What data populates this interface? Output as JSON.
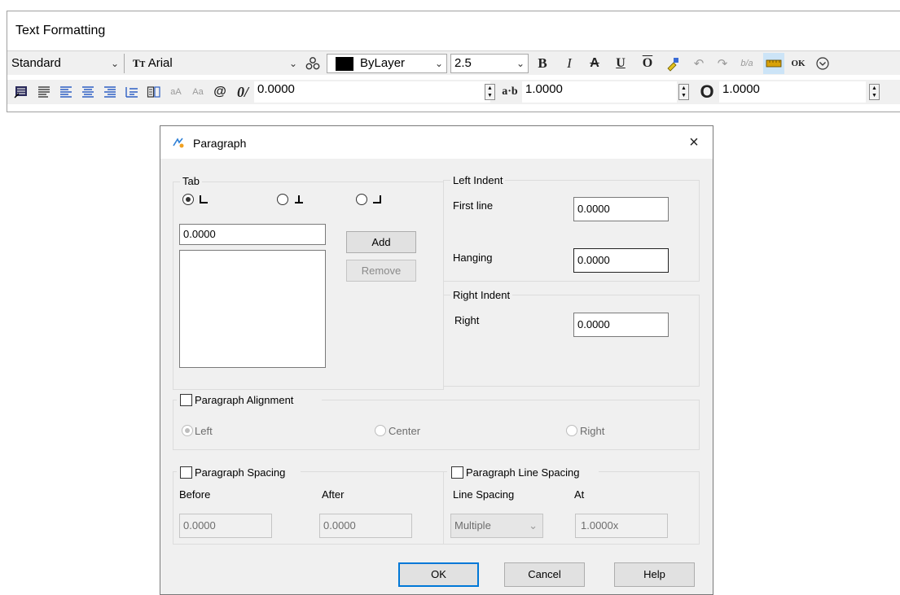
{
  "toolbar": {
    "title": "Text Formatting",
    "style": "Standard",
    "font": "Arial",
    "color": "ByLayer",
    "height": "2.5",
    "ok_label": "OK",
    "oblique_angle": "0.0000",
    "tracking": "1.0000",
    "width_factor": "1.0000",
    "colors": {
      "swatch": "#000000",
      "highlight_btn": "#cce4f7"
    }
  },
  "dialog": {
    "title": "Paragraph",
    "close_icon": "×",
    "tab": {
      "label": "Tab",
      "tab_value": "0.0000",
      "add_label": "Add",
      "remove_label": "Remove"
    },
    "left_indent": {
      "label": "Left Indent",
      "first_line_label": "First line",
      "first_line_value": "0.0000",
      "hanging_label": "Hanging",
      "hanging_value": "0.0000"
    },
    "right_indent": {
      "label": "Right Indent",
      "right_label": "Right",
      "right_value": "0.0000"
    },
    "alignment": {
      "label": "Paragraph Alignment",
      "left": "Left",
      "center": "Center",
      "right": "Right"
    },
    "spacing": {
      "label": "Paragraph Spacing",
      "before_label": "Before",
      "after_label": "After",
      "before_value": "0.0000",
      "after_value": "0.0000"
    },
    "line_spacing": {
      "label": "Paragraph Line Spacing",
      "line_spacing_label": "Line Spacing",
      "at_label": "At",
      "line_spacing_value": "Multiple",
      "at_value": "1.0000x"
    },
    "buttons": {
      "ok": "OK",
      "cancel": "Cancel",
      "help": "Help"
    }
  }
}
